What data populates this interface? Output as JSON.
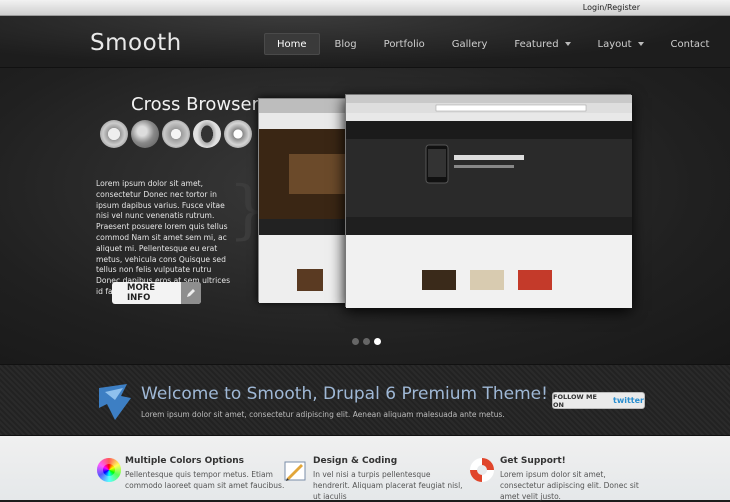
{
  "topbar": {
    "login_label": "Login/Register"
  },
  "header": {
    "logo": "Smooth",
    "nav": [
      {
        "label": "Home",
        "active": true,
        "has_dropdown": false
      },
      {
        "label": "Blog",
        "active": false,
        "has_dropdown": false
      },
      {
        "label": "Portfolio",
        "active": false,
        "has_dropdown": false
      },
      {
        "label": "Gallery",
        "active": false,
        "has_dropdown": false
      },
      {
        "label": "Featured",
        "active": false,
        "has_dropdown": true
      },
      {
        "label": "Layout",
        "active": false,
        "has_dropdown": true
      },
      {
        "label": "Contact",
        "active": false,
        "has_dropdown": false
      }
    ]
  },
  "slider": {
    "title": "Cross Browser",
    "browser_icons": [
      "safari-icon",
      "firefox-icon",
      "ie-icon",
      "opera-icon",
      "chrome-icon"
    ],
    "text": "Lorem ipsum dolor sit amet, consectetur Donec nec tortor in ipsum dapibus varius. Fusce vitae nisi vel nunc venenatis rutrum. Praesent posuere lorem quis tellus commod Nam sit amet sem mi, ac aliquet mi. Pellentesque eu erat metus, vehicula cons Quisque sed tellus non felis vulputate rutru Donec dapibus eros at sem ultrices id facilis",
    "more_button": "MORE INFO",
    "slides": 3,
    "active_slide": 3
  },
  "welcome": {
    "title": "Welcome to Smooth, Drupal 6 Premium Theme!",
    "subtitle": "Lorem ipsum dolor sit amet, consectetur adipiscing elit. Aenean aliquam malesuada ante metus.",
    "twitter_prefix": "FOLLOW ME ON",
    "twitter_brand": "twitter"
  },
  "features": [
    {
      "icon": "color-wheel-icon",
      "title": "Multiple Colors Options",
      "text": "Pellentesque quis tempor metus. Etiam commodo laoreet quam sit amet faucibus."
    },
    {
      "icon": "design-tools-icon",
      "title": "Design & Coding",
      "text": "In vel nisi a turpis pellentesque hendrerit. Aliquam placerat feugiat nisl, ut iaculis"
    },
    {
      "icon": "lifebuoy-icon",
      "title": "Get Support!",
      "text": "Lorem ipsum dolor sit amet, consectetur adipiscing elit. Donec sit amet velit justo."
    }
  ]
}
